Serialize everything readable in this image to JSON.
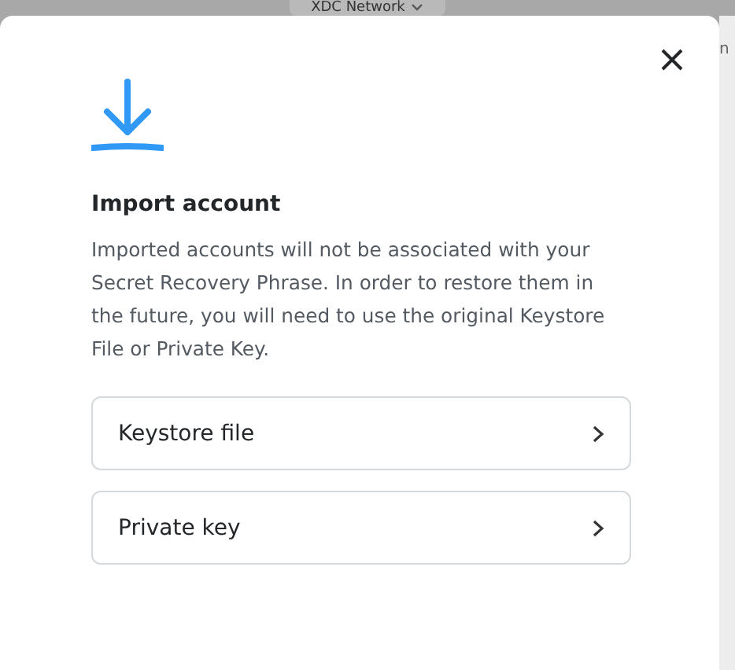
{
  "background": {
    "network_selector": "XDC Network",
    "side_text": "n"
  },
  "modal": {
    "title": "Import account",
    "description": "Imported accounts will not be associated with your Secret Recovery Phrase. In order to restore them in the future, you will need to use the original Keystore File or Private Key.",
    "options": [
      {
        "label": "Keystore file"
      },
      {
        "label": "Private key"
      }
    ]
  }
}
